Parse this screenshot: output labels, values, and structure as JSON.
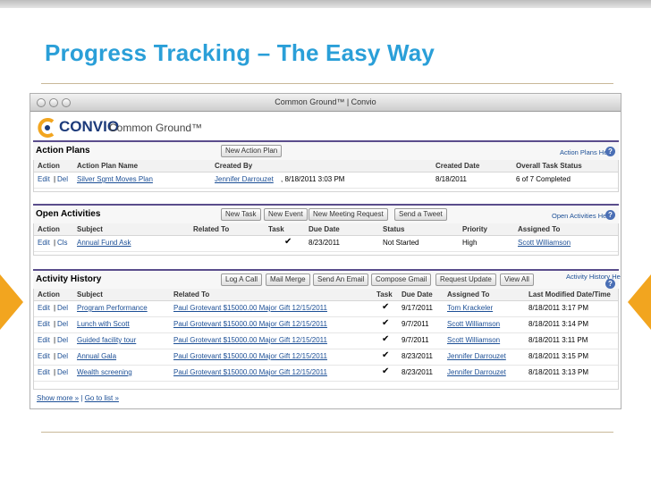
{
  "slide": {
    "title": "Progress Tracking – The Easy Way"
  },
  "window": {
    "title": "Common Ground™ | Convio"
  },
  "logo": {
    "brand": "CONVIO",
    "product": "Common Ground™"
  },
  "action_plans": {
    "title": "Action Plans",
    "new_button": "New Action Plan",
    "help": "Action Plans Help",
    "headers": [
      "Action",
      "Action Plan Name",
      "Created By",
      "Created Date",
      "Overall Task Status"
    ],
    "rows": [
      {
        "edit": "Edit",
        "del": "Del",
        "name": "Silver Sgmt Moves Plan",
        "created_by": "Jennifer Darrouzet",
        "created_by_time": ", 8/18/2011 3:03 PM",
        "created_date": "8/18/2011",
        "status": "6 of 7 Completed"
      }
    ]
  },
  "open_activities": {
    "title": "Open Activities",
    "buttons": [
      "New Task",
      "New Event",
      "New Meeting Request",
      "Send a Tweet"
    ],
    "help": "Open Activities Help",
    "headers": [
      "Action",
      "Subject",
      "Related To",
      "Task",
      "Due Date",
      "Status",
      "Priority",
      "Assigned To"
    ],
    "rows": [
      {
        "edit": "Edit",
        "del": "Cls",
        "subject": "Annual Fund Ask",
        "related": "",
        "task": "✔",
        "due": "8/23/2011",
        "status": "Not Started",
        "priority": "High",
        "assigned": "Scott Williamson"
      }
    ]
  },
  "activity_history": {
    "title": "Activity History",
    "buttons": [
      "Log A Call",
      "Mail Merge",
      "Send An Email",
      "Compose Gmail",
      "Request Update",
      "View All"
    ],
    "help": "Activity History Help",
    "headers": [
      "Action",
      "Subject",
      "Related To",
      "Task",
      "Due Date",
      "Assigned To",
      "Last Modified Date/Time"
    ],
    "rows": [
      {
        "edit": "Edit",
        "del": "Del",
        "subject": "Program Performance",
        "related": "Paul Grotevant $15000.00 Major Gift 12/15/2011",
        "task": "✔",
        "due": "9/17/2011",
        "assigned": "Tom Krackeler",
        "modified": "8/18/2011 3:17 PM"
      },
      {
        "edit": "Edit",
        "del": "Del",
        "subject": "Lunch with Scott",
        "related": "Paul Grotevant $15000.00 Major Gift 12/15/2011",
        "task": "✔",
        "due": "9/7/2011",
        "assigned": "Scott Williamson",
        "modified": "8/18/2011 3:14 PM"
      },
      {
        "edit": "Edit",
        "del": "Del",
        "subject": "Guided facility tour",
        "related": "Paul Grotevant $15000.00 Major Gift 12/15/2011",
        "task": "✔",
        "due": "9/7/2011",
        "assigned": "Scott Williamson",
        "modified": "8/18/2011 3:11 PM"
      },
      {
        "edit": "Edit",
        "del": "Del",
        "subject": "Annual Gala",
        "related": "Paul Grotevant $15000.00 Major Gift 12/15/2011",
        "task": "✔",
        "due": "8/23/2011",
        "assigned": "Jennifer Darrouzet",
        "modified": "8/18/2011 3:15 PM"
      },
      {
        "edit": "Edit",
        "del": "Del",
        "subject": "Wealth screening",
        "related": "Paul Grotevant $15000.00 Major Gift 12/15/2011",
        "task": "✔",
        "due": "8/23/2011",
        "assigned": "Jennifer Darrouzet",
        "modified": "8/18/2011 3:13 PM"
      }
    ],
    "show_more": "Show more »",
    "separator": "|",
    "go_to_list": "Go to list »"
  },
  "colors": {
    "title_blue": "#2a9fd8",
    "accent_orange": "#f2a51f",
    "section_rule": "#5a4d8c",
    "link_blue": "#1c4f96"
  }
}
